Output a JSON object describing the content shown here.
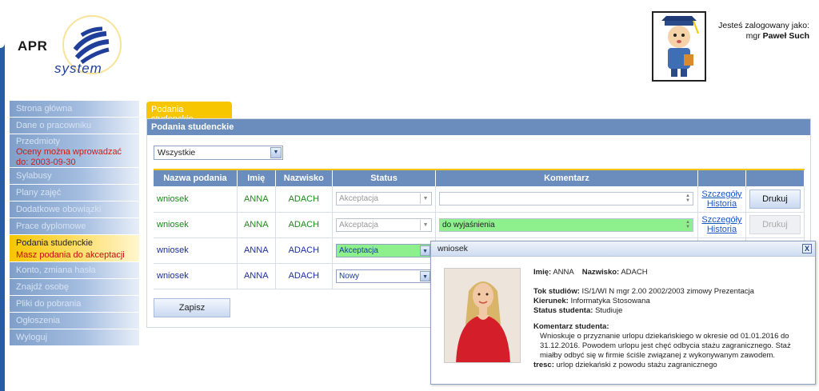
{
  "logo": {
    "apr": "APR",
    "system": "system"
  },
  "user": {
    "logged_label": "Jesteś zalogowany jako:",
    "title": "mgr",
    "name": "Paweł Such"
  },
  "sidebar": {
    "items": [
      {
        "label": "Strona główna"
      },
      {
        "label": "Dane o pracowniku"
      },
      {
        "label": "Przedmioty",
        "sub": "Oceny można wprowadzać do: 2003-09-30"
      },
      {
        "label": "Sylabusy"
      },
      {
        "label": "Plany zajęć"
      },
      {
        "label": "Dodatkowe obowiązki"
      },
      {
        "label": "Prace dyplomowe"
      },
      {
        "label": "Podania studenckie",
        "sub": "Masz podania do akceptacji"
      },
      {
        "label": "Konto, zmiana hasła"
      },
      {
        "label": "Znajdź osobę"
      },
      {
        "label": "Pliki do pobrania"
      },
      {
        "label": "Ogłoszenia"
      },
      {
        "label": "Wyloguj"
      }
    ]
  },
  "tab": {
    "label": "Podania studenckie"
  },
  "panel": {
    "title": "Podania studenckie"
  },
  "filter": {
    "value": "Wszystkie"
  },
  "table": {
    "headers": [
      "Nazwa podania",
      "Imię",
      "Nazwisko",
      "Status",
      "Komentarz",
      "",
      ""
    ],
    "rows": [
      {
        "name": "wniosek",
        "first": "ANNA",
        "last": "ADACH",
        "status": "Akceptacja",
        "comment": "",
        "link1": "Szczegóły",
        "link2": "Historia",
        "button": "Drukuj"
      },
      {
        "name": "wniosek",
        "first": "ANNA",
        "last": "ADACH",
        "status": "Akceptacja",
        "comment": "do wyjaśnienia",
        "link1": "Szczegóły",
        "link2": "Historia",
        "button": "Drukuj"
      },
      {
        "name": "wniosek",
        "first": "ANNA",
        "last": "ADACH",
        "status": "Akceptacja",
        "comment": "",
        "link1": "",
        "link2": "",
        "button": ""
      },
      {
        "name": "wniosek",
        "first": "ANNA",
        "last": "ADACH",
        "status": "Nowy",
        "comment": "",
        "link1": "",
        "link2": "",
        "button": ""
      }
    ]
  },
  "save_button": "Zapisz",
  "popup": {
    "title": "wniosek",
    "close": "X",
    "first_label": "Imię:",
    "first": "ANNA",
    "last_label": "Nazwisko:",
    "last": "ADACH",
    "tok_label": "Tok studiów:",
    "tok": "IS/1/WI N mgr 2.00 2002/2003 zimowy Prezentacja",
    "kierunek_label": "Kierunek:",
    "kierunek": "Informatyka Stosowana",
    "status_label": "Status studenta:",
    "status": "Studiuje",
    "comment_label": "Komentarz studenta:",
    "comment": "Wnioskuje o przyznanie urlopu dziekańskiego w okresie od 01.01.2016 do 31.12.2016. Powodem urlopu jest chęć odbycia stażu zagranicznego. Staż miałby odbyć się w firmie ściśle związanej z wykonywanym zawodem.",
    "tresc_label": "tresc:",
    "tresc": "urlop dziekański z powodu stażu zagranicznego"
  },
  "colors": {
    "accent": "#f7c600",
    "header_blue": "#6a8dbd",
    "green_highlight": "#8df08d",
    "alert_red": "#e0140c"
  }
}
